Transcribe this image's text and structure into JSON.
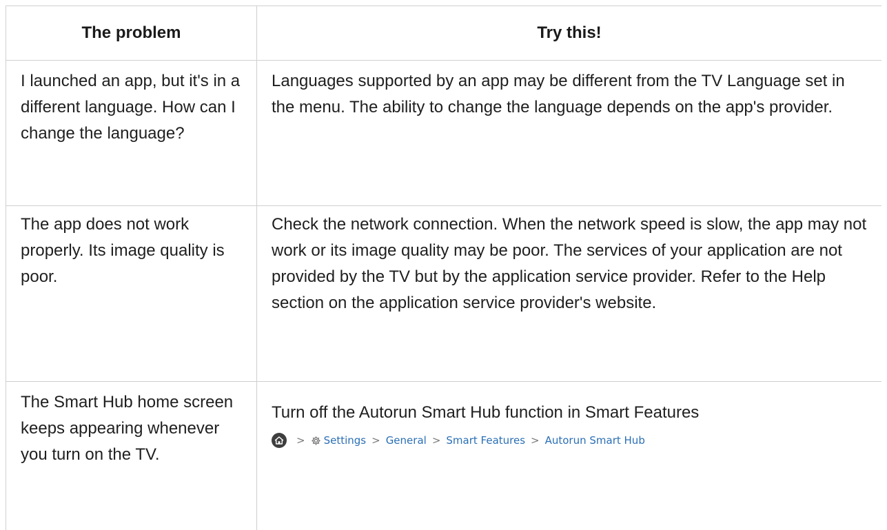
{
  "table": {
    "headers": [
      "The problem",
      "Try this!"
    ],
    "rows": [
      {
        "problem": "I launched an app, but it's in a different language. How can I change the language?",
        "solution": "Languages supported by an app may be different from the TV Language set in the menu. The ability to change the language depends on the app's provider."
      },
      {
        "problem": "The app does not work properly. Its image quality is poor.",
        "solution": "Check the network connection. When the network speed is slow, the app may not work or its image quality may be poor. The services of your application are not provided by the TV but by the application service provider. Refer to the Help section on the application service provider's website."
      },
      {
        "problem": "The Smart Hub home screen keeps appearing whenever you turn on the TV.",
        "solution": "Turn off the Autorun Smart Hub function in Smart Features"
      }
    ]
  },
  "menu_path": {
    "icons": [
      "home-icon",
      "gear-icon"
    ],
    "separator": ">",
    "items": [
      "Settings",
      "General",
      "Smart Features",
      "Autorun Smart Hub"
    ],
    "link_color": "#2a6fb5"
  }
}
